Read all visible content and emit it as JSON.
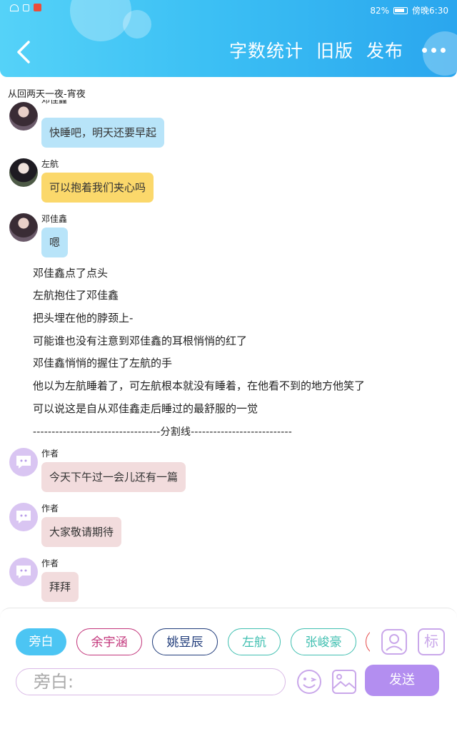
{
  "status_bar": {
    "battery": "82%",
    "time": "傍晚6:30"
  },
  "header": {
    "actions": [
      "字数统计",
      "旧版",
      "发布"
    ]
  },
  "chapter_title": "从回两天一夜-宵夜",
  "messages": [
    {
      "speaker": "邓佳鑫",
      "text": "快睡吧，明天还要早起",
      "color": "blue"
    },
    {
      "speaker": "左航",
      "text": "可以抱着我们夹心吗",
      "color": "yellow"
    },
    {
      "speaker": "邓佳鑫",
      "text": "嗯",
      "color": "blue"
    }
  ],
  "narration": [
    "邓佳鑫点了点头",
    "左航抱住了邓佳鑫",
    "把头埋在他的脖颈上-",
    "可能谁也没有注意到邓佳鑫的耳根悄悄的红了",
    "邓佳鑫悄悄的握住了左航的手",
    "他以为左航睡着了，可左航根本就没有睡着，在他看不到的地方他笑了",
    "可以说这是自从邓佳鑫走后睡过的最舒服的一觉"
  ],
  "divider": "----------------------------------分割线---------------------------",
  "author_messages": [
    {
      "speaker": "作者",
      "text": "今天下午过一会儿还有一篇"
    },
    {
      "speaker": "作者",
      "text": "大家敬请期待"
    },
    {
      "speaker": "作者",
      "text": "拜拜"
    }
  ],
  "characters": [
    {
      "name": "旁白",
      "color": "#4cc5f3"
    },
    {
      "name": "余宇涵",
      "color": "#c2347a"
    },
    {
      "name": "姚昱辰",
      "color": "#1f3b7a"
    },
    {
      "name": "左航",
      "color": "#3fbfb0"
    },
    {
      "name": "张峻豪",
      "color": "#3fbfb0"
    },
    {
      "name": "",
      "color": "#e64a4a"
    }
  ],
  "tools": {
    "mark_label": "标"
  },
  "input": {
    "placeholder": "旁白:"
  },
  "send_label": "发送",
  "colors": {
    "accent": "#3cc0f4",
    "send": "#b38ef0",
    "author_avatar": "#d9c5f2"
  }
}
